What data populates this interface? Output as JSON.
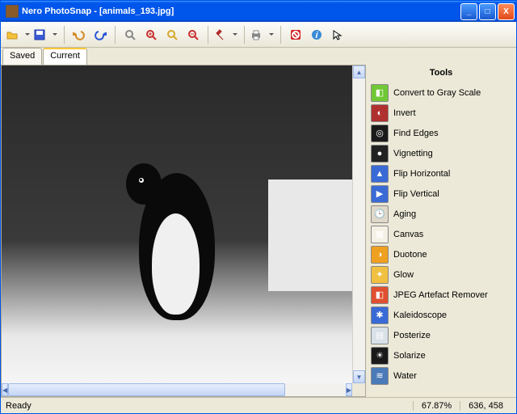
{
  "titlebar": {
    "app_name": "Nero PhotoSnap",
    "sep": " - ",
    "doc_name": "[animals_193.jpg]"
  },
  "toolbar": {
    "open": "open",
    "save": "save",
    "undo": "undo",
    "redo": "redo",
    "zoom_fit": "zoom-fit",
    "zoom_in": "zoom-in",
    "zoom_100": "zoom-100",
    "zoom_out": "zoom-out",
    "tools": "tools",
    "print": "print",
    "stop": "stop",
    "help": "help",
    "cursor": "cursor-info"
  },
  "tabs": {
    "saved": "Saved",
    "current": "Current",
    "active": "current"
  },
  "side": {
    "header": "Tools",
    "items": [
      {
        "id": "gray",
        "label": "Convert to Gray Scale",
        "icon_bg": "#71c837",
        "glyph": "◧"
      },
      {
        "id": "invert",
        "label": "Invert",
        "icon_bg": "#b03030",
        "glyph": "◐"
      },
      {
        "id": "find-edges",
        "label": "Find Edges",
        "icon_bg": "#1a1a1a",
        "glyph": "◎"
      },
      {
        "id": "vignetting",
        "label": "Vignetting",
        "icon_bg": "#222222",
        "glyph": "●"
      },
      {
        "id": "flip-h",
        "label": "Flip Horizontal",
        "icon_bg": "#3a6ad6",
        "glyph": "▲"
      },
      {
        "id": "flip-v",
        "label": "Flip Vertical",
        "icon_bg": "#3a6ad6",
        "glyph": "▶"
      },
      {
        "id": "aging",
        "label": "Aging",
        "icon_bg": "#e0d8c8",
        "glyph": "🕒"
      },
      {
        "id": "canvas",
        "label": "Canvas",
        "icon_bg": "#f4f0e4",
        "glyph": "▦"
      },
      {
        "id": "duotone",
        "label": "Duotone",
        "icon_bg": "#f0a020",
        "glyph": "◑"
      },
      {
        "id": "glow",
        "label": "Glow",
        "icon_bg": "#f0c040",
        "glyph": "✦"
      },
      {
        "id": "jpeg",
        "label": "JPEG Artefact Remover",
        "icon_bg": "#e05030",
        "glyph": "◧"
      },
      {
        "id": "kaleido",
        "label": "Kaleidoscope",
        "icon_bg": "#3a6ad6",
        "glyph": "✱"
      },
      {
        "id": "posterize",
        "label": "Posterize",
        "icon_bg": "#d8e0e8",
        "glyph": "▤"
      },
      {
        "id": "solarize",
        "label": "Solarize",
        "icon_bg": "#1a1a1a",
        "glyph": "☀"
      },
      {
        "id": "water",
        "label": "Water",
        "icon_bg": "#4a7ab8",
        "glyph": "≋"
      }
    ]
  },
  "status": {
    "ready": "Ready",
    "zoom": "67.87%",
    "coords": "636, 458"
  },
  "colors": {
    "xp_blue": "#0055ea",
    "chrome": "#ece9d8"
  }
}
